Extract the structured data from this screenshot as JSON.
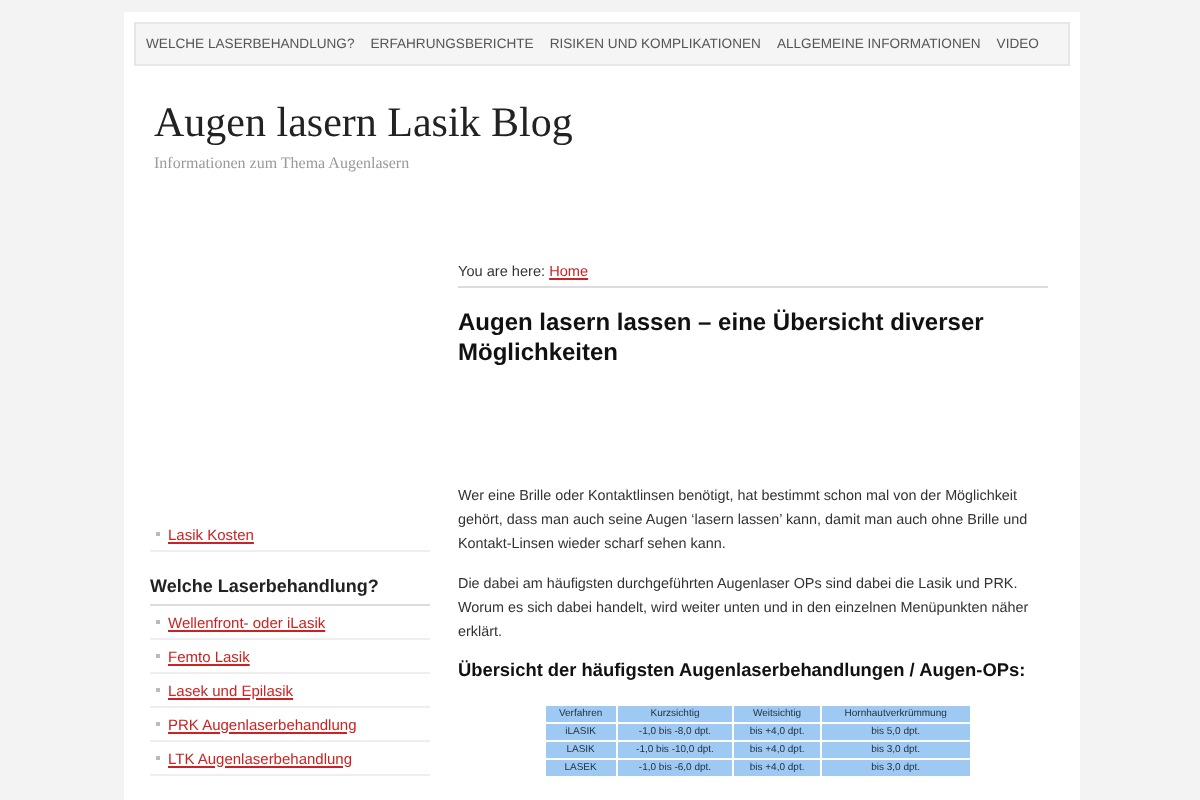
{
  "nav": {
    "items": [
      {
        "label": "WELCHE LASERBEHANDLUNG?"
      },
      {
        "label": "ERFAHRUNGSBERICHTE"
      },
      {
        "label": "RISIKEN UND KOMPLIKATIONEN"
      },
      {
        "label": "ALLGEMEINE INFORMATIONEN"
      },
      {
        "label": "VIDEO"
      }
    ]
  },
  "site": {
    "title": "Augen lasern Lasik Blog",
    "tagline": "Informationen zum Thema Augenlasern"
  },
  "sidebar": {
    "top_links": [
      "Lasik Kosten"
    ],
    "sections": [
      {
        "title": "Welche Laserbehandlung?",
        "links": [
          "Wellenfront- oder iLasik",
          "Femto Lasik",
          "Lasek und Epilasik",
          "PRK Augenlaserbehandlung",
          "LTK Augenlaserbehandlung"
        ]
      }
    ]
  },
  "breadcrumb": {
    "prefix": "You are here:",
    "link": "Home"
  },
  "article": {
    "title": "Augen lasern lassen – eine Übersicht diverser Möglichkeiten",
    "paragraphs": [
      "Wer eine Brille oder Kontaktlinsen benötigt, hat bestimmt schon mal von der Möglichkeit gehört, dass man auch seine Augen ‘lasern lassen’ kann, damit man auch ohne Brille und Kontakt-Linsen wieder scharf sehen kann.",
      "Die dabei am häufigsten durchgeführten Augenlaser OPs sind dabei die Lasik und PRK. Worum es sich dabei handelt, wird weiter unten und in den einzelnen Menüpunkten näher erklärt."
    ],
    "subheading": "Übersicht der häufigsten Augenlaserbehandlungen / Augen-OPs:",
    "table": {
      "columns": [
        "Verfahren",
        "Kurzsichtig",
        "Weitsichtig",
        "Hornhautverkrümmung"
      ],
      "rows": [
        [
          "iLASIK",
          "-1,0 bis -8,0 dpt.",
          "bis +4,0 dpt.",
          "bis 5,0 dpt."
        ],
        [
          "LASIK",
          "-1,0 bis -10,0 dpt.",
          "bis +4,0 dpt.",
          "bis 3,0 dpt."
        ],
        [
          "LASEK",
          "-1,0 bis -6,0 dpt.",
          "bis +4,0 dpt.",
          "bis 3,0 dpt."
        ]
      ]
    }
  }
}
